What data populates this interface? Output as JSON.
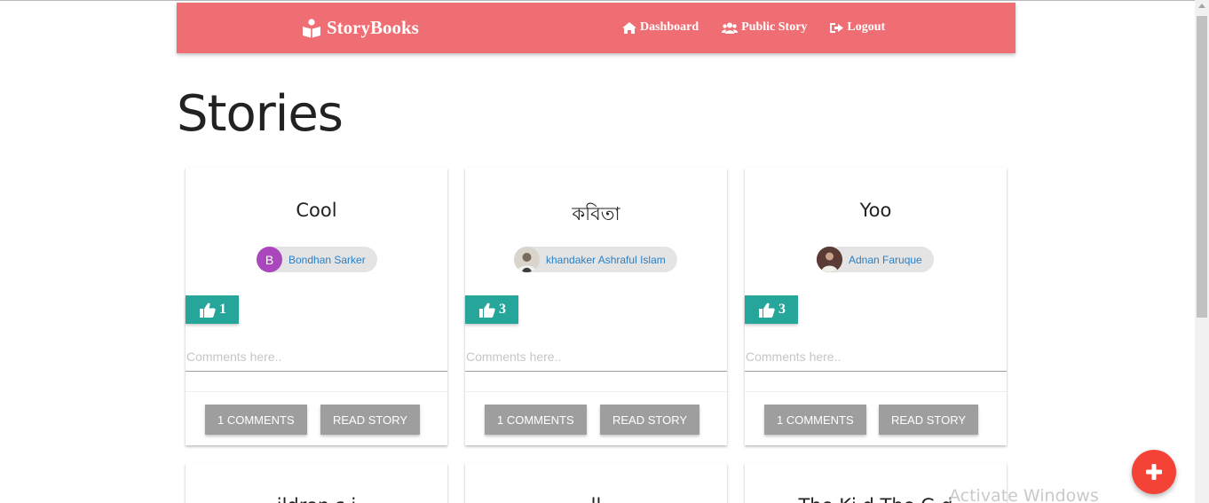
{
  "navbar": {
    "brand": "StoryBooks",
    "brand_icon": "book-reader-icon",
    "links": [
      {
        "label": "Dashboard",
        "icon": "home-icon"
      },
      {
        "label": "Public Story",
        "icon": "users-icon"
      },
      {
        "label": "Logout",
        "icon": "sign-out-icon"
      }
    ],
    "color": "#ef6e73"
  },
  "page": {
    "title": "Stories"
  },
  "cards": [
    {
      "title": "Cool",
      "author": "Bondhan Sarker",
      "avatar_letter": "B",
      "avatar_color": "#ab47bc",
      "likes": "1",
      "comment_placeholder": "Comments here..",
      "comments_button": "1 COMMENTS",
      "read_button": "READ STORY"
    },
    {
      "title": "কবিতা",
      "author": "khandaker Ashraful Islam",
      "avatar_letter": "",
      "avatar_color": "#7a6a5a",
      "likes": "3",
      "comment_placeholder": "Comments here..",
      "comments_button": "1 COMMENTS",
      "read_button": "READ STORY"
    },
    {
      "title": "Yoo",
      "author": "Adnan Faruque",
      "avatar_letter": "",
      "avatar_color": "#5a3b35",
      "likes": "3",
      "comment_placeholder": "Comments here..",
      "comments_button": "1 COMMENTS",
      "read_button": "READ STORY"
    }
  ],
  "next_row_titles": [
    "ildren s i",
    "ll",
    "The Ki      d The G  d"
  ],
  "colors": {
    "like": "#26a69a",
    "button_grey": "#9e9e9e",
    "fab": "#f44336",
    "author_link": "#2a7fc4"
  },
  "fab_icon": "plus-icon",
  "watermark": "Activate Windows"
}
